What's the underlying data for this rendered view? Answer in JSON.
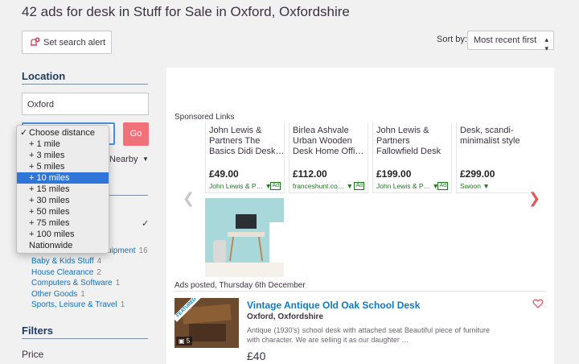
{
  "header": {
    "title": "42 ads for desk in Stuff for Sale in Oxford, Oxfordshire",
    "alert_label": "Set search alert",
    "sort_label": "Sort by:",
    "sort_value": "Most recent first"
  },
  "sidebar": {
    "location_heading": "Location",
    "location_value": "Oxford",
    "go_label": "Go",
    "nearby_label": "Nearby",
    "distance_options": [
      "Choose distance",
      "+ 1 mile",
      "+ 3 miles",
      "+ 5 miles",
      "+ 10 miles",
      "+ 15 miles",
      "+ 30 miles",
      "+ 50 miles",
      "+ 75 miles",
      "+ 100 miles",
      "Nationwide"
    ],
    "partial_category": {
      "label": "uipment",
      "count": "16"
    },
    "categories": [
      {
        "label": "Baby & Kids Stuff",
        "count": "4"
      },
      {
        "label": "House Clearance",
        "count": "2"
      },
      {
        "label": "Computers & Software",
        "count": "1"
      },
      {
        "label": "Other Goods",
        "count": "1"
      },
      {
        "label": "Sports, Leisure & Travel",
        "count": "1"
      }
    ],
    "filters_heading": "Filters",
    "price_label": "Price"
  },
  "sponsored": {
    "label": "Sponsored Links",
    "ads": [
      {
        "title": "John Lewis & Partners The Basics Didi Desk…",
        "price": "£49.00",
        "merchant": "John Lewis & P… ▼",
        "badge": "Ad"
      },
      {
        "title": "Birlea Ashvale Urban Wooden Desk Home Offi…",
        "price": "£112.00",
        "merchant": "franceshunt.co… ▼",
        "badge": "Ad"
      },
      {
        "title": "John Lewis & Partners Fallowfield Desk",
        "price": "£199.00",
        "merchant": "John Lewis & P… ▼",
        "badge": "Ad"
      },
      {
        "title": "Desk, scandi-minimalist style",
        "price": "£299.00",
        "merchant": "Swoon ▼",
        "badge": ""
      }
    ]
  },
  "listings": {
    "posted_label": "Ads posted, Thursday 6th December",
    "items": [
      {
        "title": "Vintage Antique Old Oak School Desk",
        "location": "Oxford, Oxfordshire",
        "description": "Antique (1930's) school desk with attached seat Beautiful piece of furniture with character. We are selling it as our daughter …",
        "price": "£40",
        "featured": "FEATURED",
        "photo_count": "5"
      }
    ]
  },
  "colors": {
    "accent": "#0b7ac9",
    "go": "#f0717a",
    "selected": "#2f76d8"
  }
}
